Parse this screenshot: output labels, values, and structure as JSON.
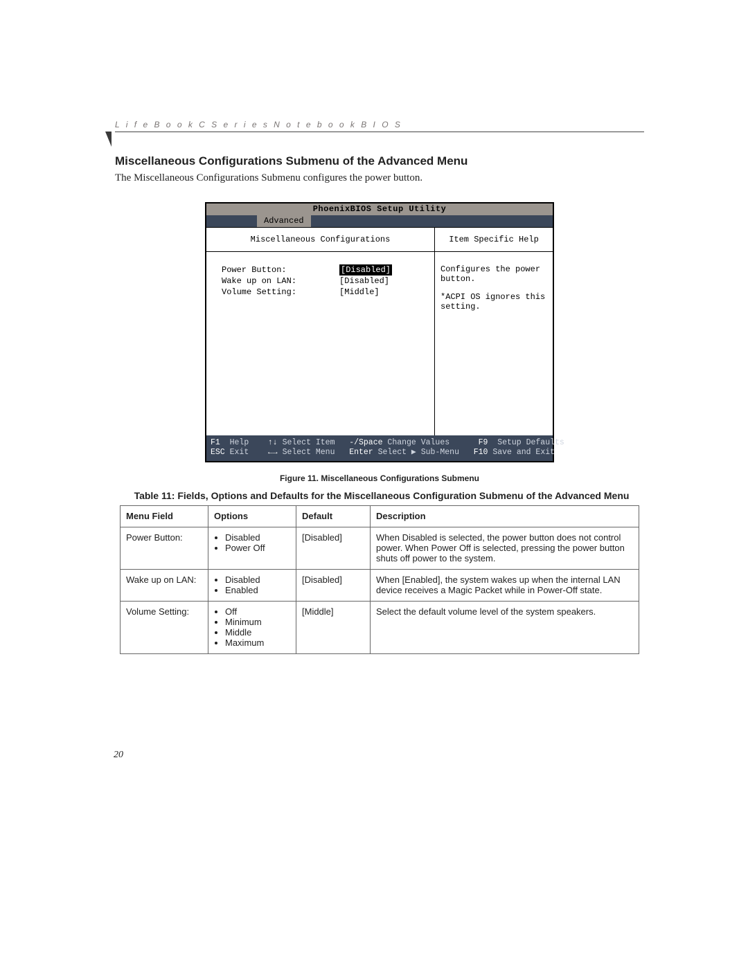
{
  "running_head": "L i f e B o o k   C   S e r i e s   N o t e b o o k   B I O S",
  "section_title": "Miscellaneous Configurations Submenu of the Advanced Menu",
  "intro": "The Miscellaneous Configurations Submenu configures the power button.",
  "bios": {
    "utility_title": "PhoenixBIOS Setup Utility",
    "active_tab": "Advanced",
    "left_heading": "Miscellaneous Configurations",
    "right_heading": "Item Specific Help",
    "settings": [
      {
        "label": "Power Button:",
        "value": "[Disabled]",
        "selected": true
      },
      {
        "label": "Wake up on LAN:",
        "value": "[Disabled]",
        "selected": false
      },
      {
        "label": "Volume Setting:",
        "value": "[Middle]",
        "selected": false
      }
    ],
    "help_line1": "Configures the power button.",
    "help_line2": "*ACPI OS ignores this setting.",
    "footer": {
      "f1": "F1",
      "help": "Help",
      "updown": "↑↓",
      "select_item": "Select Item",
      "minus_space": "-/Space",
      "change_values": "Change Values",
      "f9": "F9",
      "setup_defaults": "Setup Defaults",
      "esc": "ESC",
      "exit": "Exit",
      "leftright": "←→",
      "select_menu": "Select Menu",
      "enter": "Enter",
      "select_submenu": "Select ▶ Sub-Menu",
      "f10": "F10",
      "save_exit": "Save and Exit"
    }
  },
  "figure_caption": "Figure 11.  Miscellaneous Configurations Submenu",
  "table_caption": "Table 11: Fields, Options and Defaults for the Miscellaneous Configuration Submenu of the Advanced Menu",
  "table": {
    "headers": {
      "field": "Menu Field",
      "options": "Options",
      "default": "Default",
      "desc": "Description"
    },
    "rows": [
      {
        "field": "Power Button:",
        "options": [
          "Disabled",
          "Power Off"
        ],
        "default": "[Disabled]",
        "desc": "When Disabled is selected, the power button does not control power. When Power Off is selected, pressing the power button shuts off power to the system."
      },
      {
        "field": "Wake up on LAN:",
        "options": [
          "Disabled",
          "Enabled"
        ],
        "default": "[Disabled]",
        "desc": "When [Enabled], the system wakes up when the internal LAN device receives a Magic Packet while in Power-Off state."
      },
      {
        "field": "Volume Setting:",
        "options": [
          "Off",
          "Minimum",
          "Middle",
          "Maximum"
        ],
        "default": "[Middle]",
        "desc": "Select the default volume level of the system speakers."
      }
    ]
  },
  "page_number": "20"
}
